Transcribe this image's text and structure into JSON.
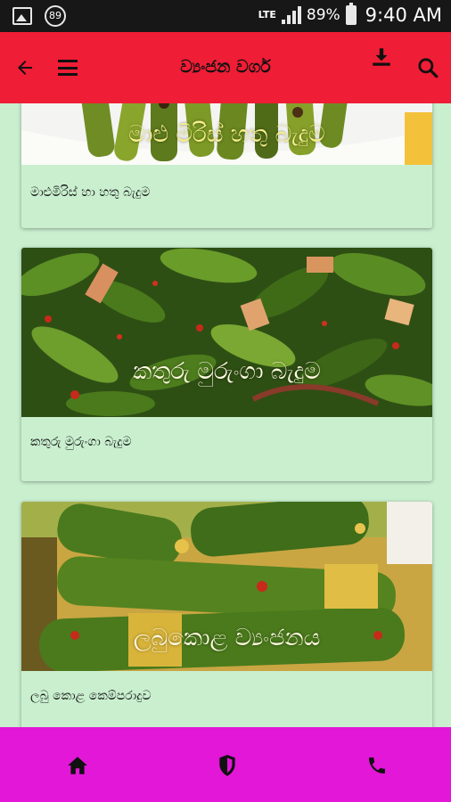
{
  "status_bar": {
    "notification_badge": "89",
    "network": "LTE",
    "battery": "89%",
    "time": "9:40 AM"
  },
  "app_bar": {
    "title": "ව්‍යංජන වර්ග",
    "icons": [
      "back-arrow-icon",
      "menu-icon",
      "download-icon",
      "search-icon"
    ]
  },
  "recipes": [
    {
      "overlay": "මාළු මිරිස් හතු බැදුම",
      "caption": "මාළුමිරිස් හා හතු බැදුම"
    },
    {
      "overlay": "කතුරු මුරුංගා බැදුම",
      "caption": "කතුරු මුරුංගා බැදුම"
    },
    {
      "overlay": "ලබුකොළ ව්‍යංජනය",
      "caption": "ලබු කොළ කෙම්පරාදුව"
    }
  ],
  "bottom_nav": {
    "icons": [
      "home-icon",
      "shield-icon",
      "phone-icon"
    ]
  },
  "colors": {
    "app_bar": "#ef1d35",
    "bottom_bar": "#e217d7",
    "background": "#c9efcf",
    "status_bar": "#171717"
  }
}
